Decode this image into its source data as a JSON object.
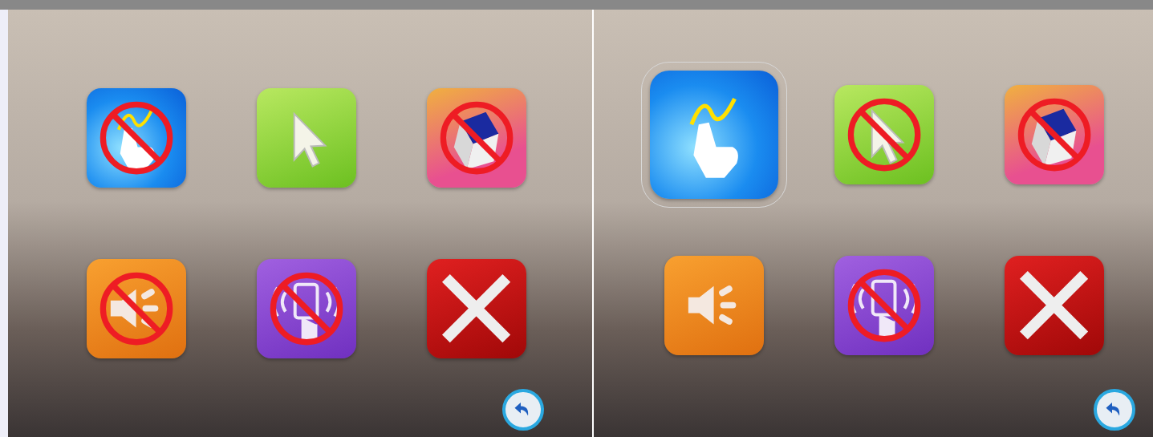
{
  "panels": [
    {
      "tools": [
        {
          "kind": "draw",
          "disabled": true,
          "selected": false
        },
        {
          "kind": "pointer",
          "disabled": false,
          "selected": false
        },
        {
          "kind": "eraser",
          "disabled": true,
          "selected": false
        },
        {
          "kind": "sound",
          "disabled": true,
          "selected": false
        },
        {
          "kind": "vibrate",
          "disabled": true,
          "selected": false
        },
        {
          "kind": "close",
          "disabled": false,
          "selected": false
        }
      ]
    },
    {
      "tools": [
        {
          "kind": "draw",
          "disabled": false,
          "selected": true
        },
        {
          "kind": "pointer",
          "disabled": true,
          "selected": false
        },
        {
          "kind": "eraser",
          "disabled": true,
          "selected": false
        },
        {
          "kind": "sound",
          "disabled": false,
          "selected": false
        },
        {
          "kind": "vibrate",
          "disabled": true,
          "selected": false
        },
        {
          "kind": "close",
          "disabled": false,
          "selected": false
        }
      ]
    }
  ]
}
